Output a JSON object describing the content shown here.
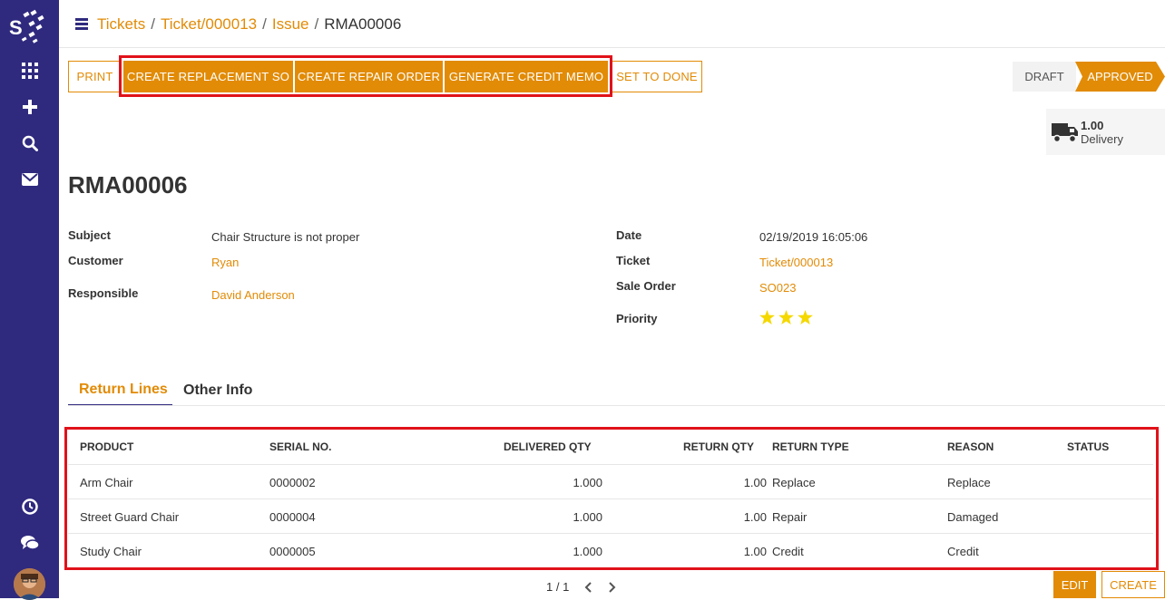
{
  "breadcrumb": {
    "items": [
      {
        "label": "Tickets",
        "link": true
      },
      {
        "label": "Ticket/000013",
        "link": true
      },
      {
        "label": "Issue",
        "link": true
      },
      {
        "label": "RMA00006",
        "link": false
      }
    ]
  },
  "toolbar": {
    "print": "PRINT",
    "create_replacement_so": "CREATE REPLACEMENT SO",
    "create_repair_order": "CREATE REPAIR ORDER",
    "generate_credit_memo": "GENERATE CREDIT MEMO",
    "set_to_done": "SET TO DONE"
  },
  "status": {
    "draft": "DRAFT",
    "approved": "APPROVED"
  },
  "smart_button": {
    "value": "1.00",
    "label": "Delivery"
  },
  "record": {
    "title": "RMA00006",
    "subject_label": "Subject",
    "subject": "Chair Structure is not proper",
    "customer_label": "Customer",
    "customer": "Ryan",
    "responsible_label": "Responsible",
    "responsible": "David Anderson",
    "date_label": "Date",
    "date": "02/19/2019 16:05:06",
    "ticket_label": "Ticket",
    "ticket": "Ticket/000013",
    "sale_order_label": "Sale Order",
    "sale_order": "SO023",
    "priority_label": "Priority",
    "priority": 3
  },
  "tabs": {
    "return_lines": "Return Lines",
    "other_info": "Other Info"
  },
  "table": {
    "columns": [
      "PRODUCT",
      "SERIAL NO.",
      "DELIVERED QTY",
      "RETURN QTY",
      "RETURN TYPE",
      "REASON",
      "STATUS"
    ],
    "rows": [
      [
        "Arm Chair",
        "0000002",
        "1.000",
        "1.00",
        "Replace",
        "Replace",
        ""
      ],
      [
        "Street Guard Chair",
        "0000004",
        "1.000",
        "1.00",
        "Repair",
        "Damaged",
        ""
      ],
      [
        "Study Chair",
        "0000005",
        "1.000",
        "1.00",
        "Credit",
        "Credit",
        ""
      ]
    ]
  },
  "pager": {
    "value": "1 / 1"
  },
  "footer_buttons": {
    "edit": "EDIT",
    "create": "CREATE"
  },
  "colors": {
    "sidebar": "#2f2a7e",
    "accent": "#e28b06",
    "highlight": "#e0121a",
    "star": "#f5d800"
  }
}
